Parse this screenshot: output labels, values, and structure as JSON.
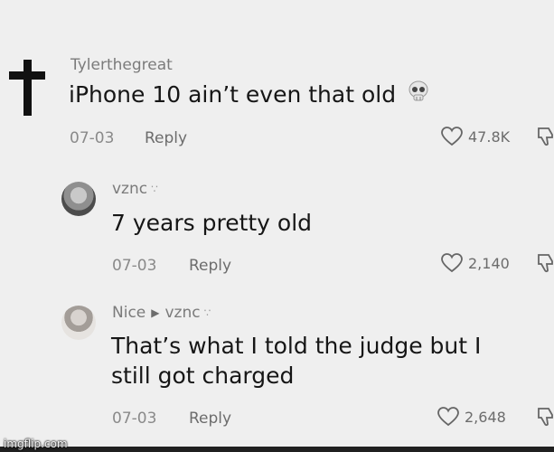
{
  "comments": [
    {
      "username": "Tylerthegreat",
      "text": "iPhone 10 ain’t even that old",
      "emoji_icon": "skull-emoji",
      "date": "07-03",
      "reply_label": "Reply",
      "likes": "47.8K"
    },
    {
      "username": "vznc",
      "badge": "∵",
      "text": "7 years pretty old",
      "date": "07-03",
      "reply_label": "Reply",
      "likes": "2,140"
    },
    {
      "username": "Nice",
      "reply_to": "vznc",
      "badge": "∵",
      "text_line1": "That’s what I told the judge but I",
      "text_line2": "still got charged",
      "date": "07-03",
      "reply_label": "Reply",
      "likes": "2,648"
    }
  ],
  "watermark": "imgflip.com",
  "icons": {
    "avatar1": "cross-icon",
    "like": "heart-outline-icon",
    "dislike": "thumbs-down-icon"
  }
}
